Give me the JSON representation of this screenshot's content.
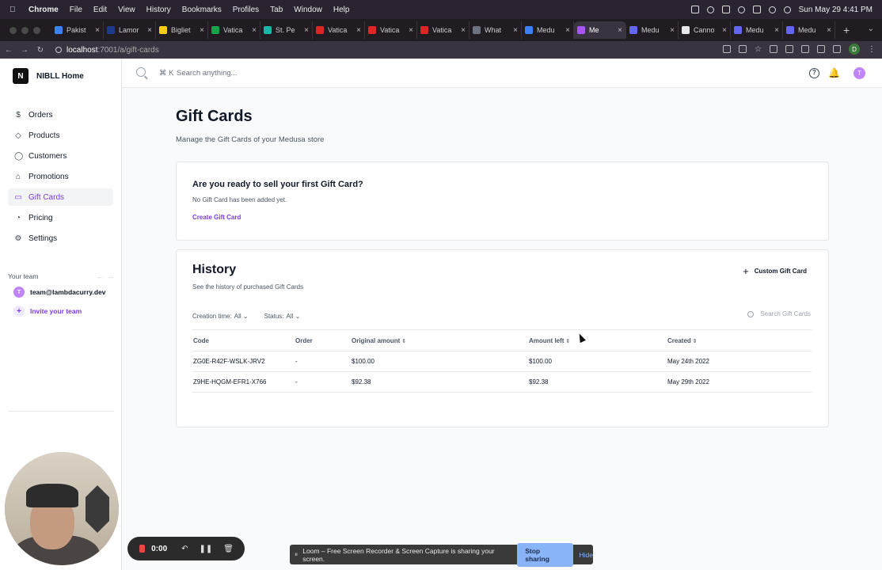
{
  "menubar": {
    "app": "Chrome",
    "items": [
      "File",
      "Edit",
      "View",
      "History",
      "Bookmarks",
      "Profiles",
      "Tab",
      "Window",
      "Help"
    ],
    "datetime": "Sun May 29  4:41 PM"
  },
  "tabs": [
    {
      "label": "Pakist",
      "color": "#3b82f6"
    },
    {
      "label": "Lamor",
      "color": "#1e3a8a"
    },
    {
      "label": "Bigliet",
      "color": "#facc15"
    },
    {
      "label": "Vatica",
      "color": "#16a34a"
    },
    {
      "label": "St. Pe",
      "color": "#14b8a6"
    },
    {
      "label": "Vatica",
      "color": "#dc2626"
    },
    {
      "label": "Vatica",
      "color": "#dc2626"
    },
    {
      "label": "Vatica",
      "color": "#dc2626"
    },
    {
      "label": "What",
      "color": "#6b7280"
    },
    {
      "label": "Medu",
      "color": "#3b82f6"
    },
    {
      "label": "Me",
      "color": "#a855f7",
      "active": true
    },
    {
      "label": "Medu",
      "color": "#6366f1"
    },
    {
      "label": "Canno",
      "color": "#e5e7eb"
    },
    {
      "label": "Medu",
      "color": "#6366f1"
    },
    {
      "label": "Medu",
      "color": "#6366f1"
    }
  ],
  "address": {
    "host": "localhost",
    "path": ":7001/a/gift-cards"
  },
  "profile_initial": "D",
  "sidebar": {
    "store_initial": "N",
    "store_name": "NIBLL Home",
    "items": [
      {
        "label": "Orders",
        "icon": "$"
      },
      {
        "label": "Products",
        "icon": "◇"
      },
      {
        "label": "Customers",
        "icon": "◯"
      },
      {
        "label": "Promotions",
        "icon": "⌂"
      },
      {
        "label": "Gift Cards",
        "icon": "▭",
        "active": true
      },
      {
        "label": "Pricing",
        "icon": "◔"
      },
      {
        "label": "Settings",
        "icon": "⚙"
      }
    ],
    "team_header": "Your team",
    "member_initial": "T",
    "member_email": "team@lambdacurry.dev",
    "invite_label": "Invite your team"
  },
  "topbar": {
    "shortcut": "⌘ K",
    "search_placeholder": "Search anything...",
    "user_initial": "T"
  },
  "page": {
    "title": "Gift Cards",
    "subtitle": "Manage the Gift Cards of your Medusa store"
  },
  "first_card": {
    "heading": "Are you ready to sell your first Gift Card?",
    "description": "No Gift Card has been added yet.",
    "create_label": "Create Gift Card"
  },
  "history": {
    "heading": "History",
    "description": "See the history of purchased Gift Cards",
    "custom_label": "Custom Gift Card",
    "filter_creation_label": "Creation time:",
    "filter_creation_value": "All",
    "filter_status_label": "Status:",
    "filter_status_value": "All",
    "search_placeholder": "Search Gift Cards",
    "columns": [
      "Code",
      "Order",
      "Original amount",
      "Amount left",
      "Created"
    ],
    "rows": [
      {
        "code": "ZG0E-R42F-WSLK-JRV2",
        "order": "-",
        "original": "$100.00",
        "left": "$100.00",
        "created": "May 24th 2022"
      },
      {
        "code": "Z9HE-HQGM-EFR1-X766",
        "order": "-",
        "original": "$92.38",
        "left": "$92.38",
        "created": "May 29th 2022"
      }
    ]
  },
  "recorder": {
    "time": "0:00"
  },
  "share_banner": {
    "text": "Loom – Free Screen Recorder & Screen Capture is sharing your screen.",
    "stop_label": "Stop sharing",
    "hide_label": "Hide"
  }
}
